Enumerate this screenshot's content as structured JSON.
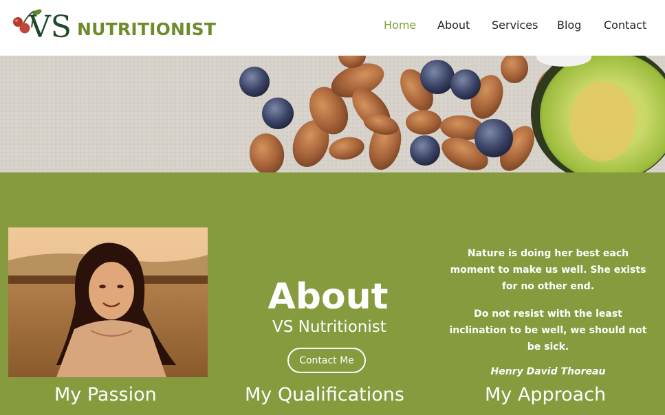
{
  "brand": {
    "name": "NUTRITIONIST",
    "initials": "VS"
  },
  "nav": {
    "items": [
      {
        "label": "Home",
        "active": true
      },
      {
        "label": "About",
        "active": false
      },
      {
        "label": "Services",
        "active": false
      },
      {
        "label": "Blog",
        "active": false
      },
      {
        "label": "Contact",
        "active": false
      }
    ]
  },
  "about": {
    "title": "About",
    "subtitle": "VS Nutritionist",
    "contact_label": "Contact Me"
  },
  "quote": {
    "line1": "Nature is doing her best each moment to make us well. She exists for no other end.",
    "line2": "Do not resist with the least inclination to be well, we should not be sick.",
    "author": "Henry David Thoreau"
  },
  "features": [
    "My Passion",
    "My Qualifications",
    "My Approach"
  ],
  "colors": {
    "accent": "#869b3e",
    "nav_active": "#7ea03b",
    "brand": "#6e8c2c"
  }
}
